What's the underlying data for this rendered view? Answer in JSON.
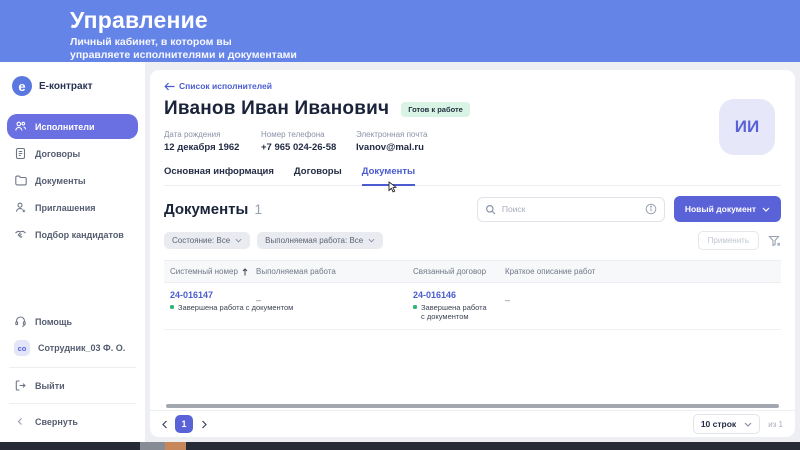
{
  "banner": {
    "title": "Управление",
    "subtitle_line1": "Личный кабинет, в котором вы",
    "subtitle_line2": "управляете исполнителями и документами"
  },
  "sidebar": {
    "brand": "Е-контракт",
    "items": [
      {
        "label": "Исполнители",
        "icon": "people-icon",
        "active": true
      },
      {
        "label": "Договоры",
        "icon": "contract-icon",
        "active": false
      },
      {
        "label": "Документы",
        "icon": "folder-icon",
        "active": false
      },
      {
        "label": "Приглашения",
        "icon": "person-add-icon",
        "active": false
      },
      {
        "label": "Подбор кандидатов",
        "icon": "handshake-icon",
        "active": false
      }
    ],
    "footer": {
      "help": "Помощь",
      "user": "Сотрудник_03 Ф. О.",
      "user_initials": "со",
      "logout": "Выйти",
      "collapse": "Свернуть"
    }
  },
  "profile": {
    "back_link": "Список исполнителей",
    "name": "Иванов Иван Иванович",
    "status_badge": "Готов к работе",
    "initials": "ИИ",
    "fields": [
      {
        "label": "Дата рождения",
        "value": "12 декабря 1962"
      },
      {
        "label": "Номер телефона",
        "value": "+7 965 024-26-58"
      },
      {
        "label": "Электронная почта",
        "value": "Ivanov@mal.ru"
      }
    ],
    "tabs": [
      {
        "label": "Основная информация",
        "active": false
      },
      {
        "label": "Договоры",
        "active": false
      },
      {
        "label": "Документы",
        "active": true
      }
    ]
  },
  "documents": {
    "title": "Документы",
    "count": "1",
    "search_placeholder": "Поиск",
    "new_button": "Новый документ",
    "filters": [
      {
        "label": "Состояние: Все"
      },
      {
        "label": "Выполняемая работа: Все"
      }
    ],
    "apply_button": "Применить",
    "table": {
      "columns": [
        "Системный номер",
        "Выполняемая работа",
        "Связанный договор",
        "Краткое описание работ"
      ],
      "rows": [
        {
          "system_number": "24-016147",
          "system_status": "Завершена работа с документом",
          "work": "–",
          "contract": "24-016146",
          "contract_status": "Завершена работа с документом",
          "description": "–"
        }
      ]
    },
    "pagination": {
      "page": "1",
      "rows_per_page": "10 строк",
      "of_label": "из 1"
    }
  },
  "colors": {
    "banner": "#6584e8",
    "accent": "#5a62d8",
    "active_nav": "#6a70e2",
    "link": "#4a5cd0",
    "status_green": "#2eb873",
    "badge_bg": "#d9f3e5"
  }
}
